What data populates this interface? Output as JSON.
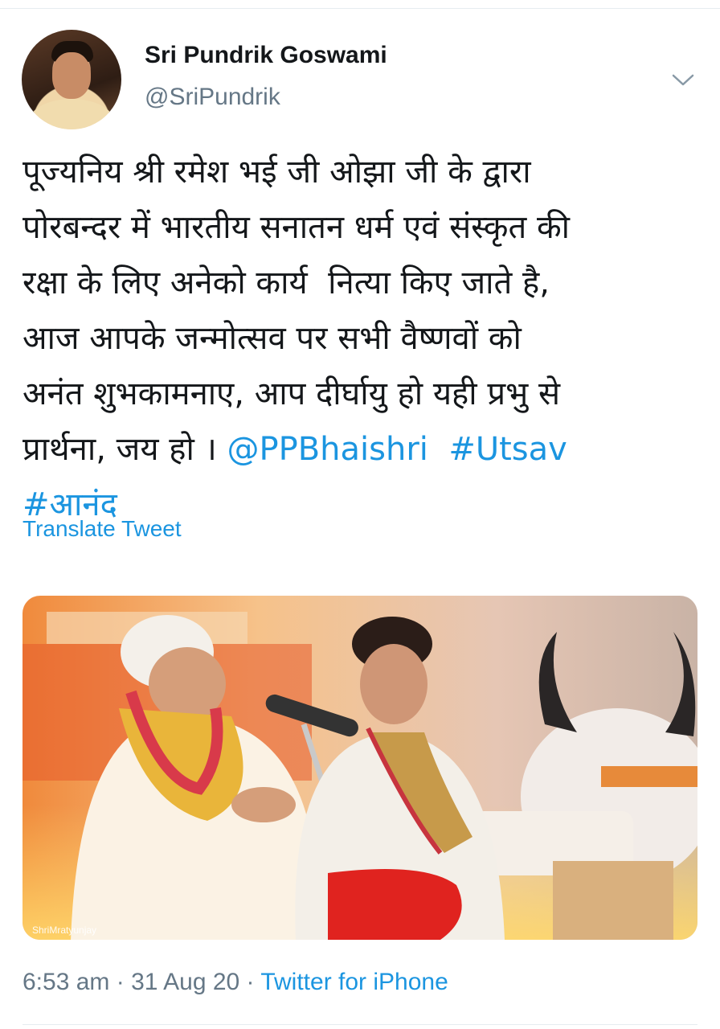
{
  "author": {
    "display_name": "Sri Pundrik Goswami",
    "handle": "@SriPundrik"
  },
  "tweet": {
    "lines": [
      [
        {
          "text": "पूज्यनिय श्री रमेश भई जी ओझा जी के द्वारा",
          "kind": "text"
        }
      ],
      [
        {
          "text": "पोरबन्दर में भारतीय सनातन धर्म एवं संस्कृत की",
          "kind": "text"
        }
      ],
      [
        {
          "text": "रक्षा के लिए अनेको कार्य  नित्या किए जाते है,",
          "kind": "text"
        }
      ],
      [
        {
          "text": "आज आपके जन्मोत्सव पर सभी वैष्णवों को",
          "kind": "text"
        }
      ],
      [
        {
          "text": "अनंत शुभकामनाए, आप दीर्घायु हो यही प्रभु से",
          "kind": "text"
        }
      ],
      [
        {
          "text": "प्रार्थना, जय हो । ",
          "kind": "text"
        },
        {
          "text": "@PPBhaishri",
          "kind": "link"
        },
        {
          "text": "  ",
          "kind": "text"
        },
        {
          "text": "#Utsav",
          "kind": "link"
        }
      ],
      [
        {
          "text": "#आनंद",
          "kind": "link"
        }
      ]
    ],
    "translate_label": "Translate Tweet"
  },
  "media": {
    "watermark": "ShriMratyunjay"
  },
  "meta": {
    "time": "6:53 am",
    "separator": " · ",
    "date": "31 Aug 20",
    "source": "Twitter for iPhone"
  },
  "colors": {
    "link": "#1b95e0",
    "secondary_text": "#657786",
    "primary_text": "#14171a",
    "divider": "#e6ecf0"
  },
  "icons": {
    "caret": "chevron-down-icon"
  }
}
